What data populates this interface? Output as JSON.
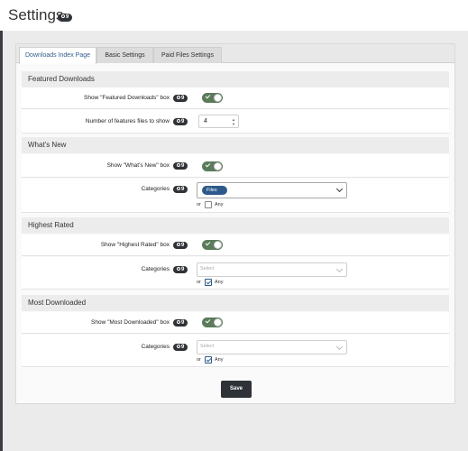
{
  "header": {
    "title": "Settings",
    "badge_text": "9"
  },
  "tabs": [
    {
      "label": "Downloads Index Page",
      "active": true
    },
    {
      "label": "Basic Settings",
      "active": false
    },
    {
      "label": "Paid Files Settings",
      "active": false
    }
  ],
  "sections": {
    "featured": {
      "title": "Featured Downloads",
      "show_label": "Show \"Featured Downloads\" box",
      "count_label": "Number of features files to show",
      "count_value": "4",
      "badge_text": "9"
    },
    "whats_new": {
      "title": "What's New",
      "show_label": "Show \"What's New\" box",
      "categories_label": "Categories",
      "selected_chip": "Files",
      "or_text": "or",
      "any_text": "Any",
      "any_checked": false,
      "badge_text": "9"
    },
    "highest_rated": {
      "title": "Highest Rated",
      "show_label": "Show \"Highest Rated\" box",
      "categories_label": "Categories",
      "placeholder": "Select",
      "or_text": "or",
      "any_text": "Any",
      "any_checked": true,
      "badge_text": "9"
    },
    "most_downloaded": {
      "title": "Most Downloaded",
      "show_label": "Show \"Most Downloaded\" box",
      "categories_label": "Categories",
      "placeholder": "Select",
      "or_text": "or",
      "any_text": "Any",
      "any_checked": true,
      "badge_text": "9"
    }
  },
  "save_label": "Save",
  "colors": {
    "accent": "#2d5a8a",
    "toggle_on": "#5b7b5b",
    "dark": "#2f3237"
  }
}
